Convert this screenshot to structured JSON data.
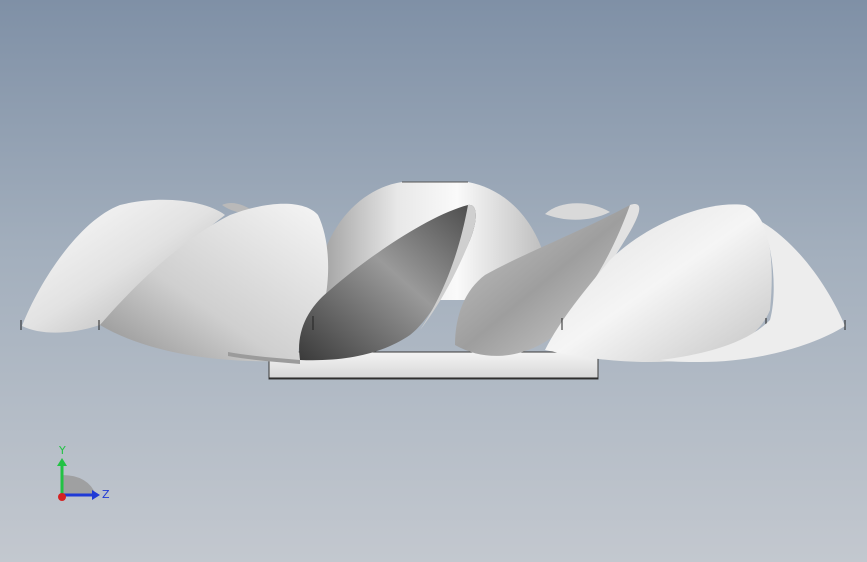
{
  "viewport": {
    "background_top": "#7f90a6",
    "background_bottom": "#c3c8cf"
  },
  "model": {
    "type": "propeller-impeller",
    "blade_count_visible": 7
  },
  "triad": {
    "y_label": "Y",
    "z_label": "Z",
    "y_color": "#22c244",
    "z_color": "#1f3ad6",
    "x_color": "#d42222"
  }
}
